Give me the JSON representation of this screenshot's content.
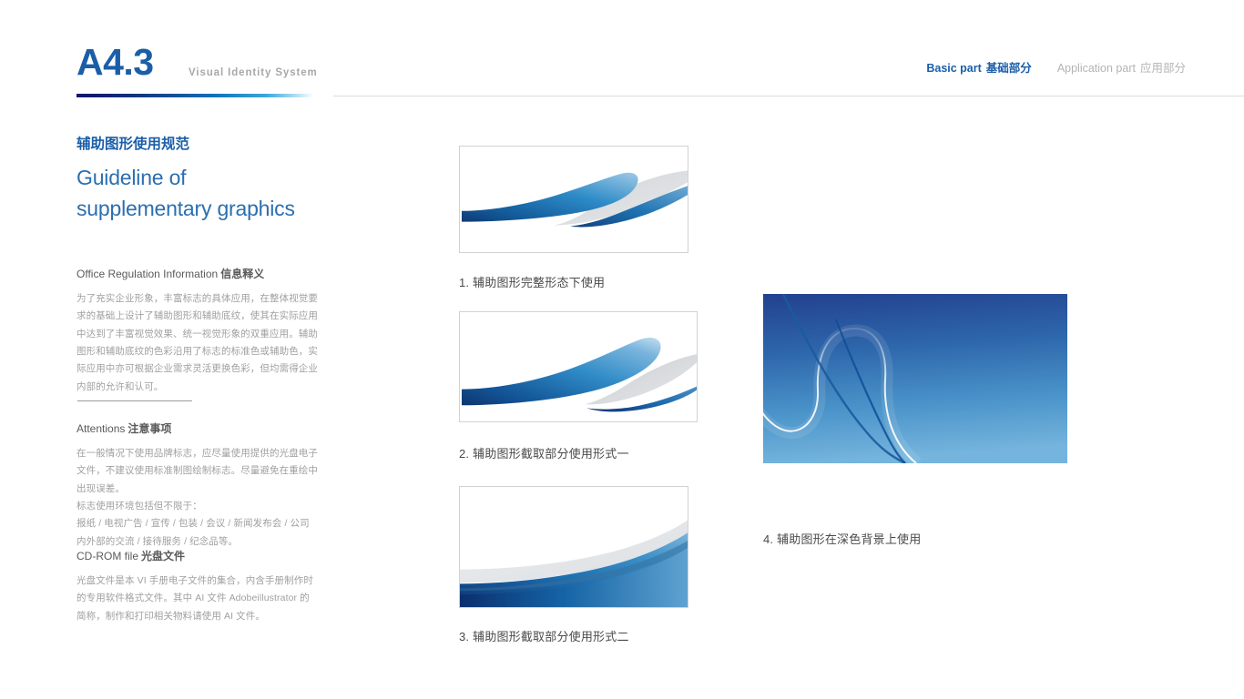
{
  "header": {
    "page_code": "A4.3",
    "subtitle": "Visual Identity System",
    "nav": [
      {
        "id": "basic",
        "en": "Basic part",
        "cn": "基础部分",
        "active": true
      },
      {
        "id": "application",
        "en": "Application part",
        "cn": "应用部分",
        "active": false
      }
    ],
    "accent_color": "#1b5ea8",
    "rule_color": "#dcdcdc"
  },
  "left_column": {
    "section_title_cn": "辅助图形使用规范",
    "section_title_en": "Guideline of supplementary graphics",
    "blocks": [
      {
        "id": "office-regulation",
        "head_en": "Office Regulation Information",
        "head_cn": "信息释义",
        "body": "为了充实企业形象，丰富标志的具体应用，在整体视觉要求的基础上设计了辅助图形和辅助底纹，使其在实际应用中达到了丰富视觉效果、统一视觉形象的双重应用。辅助图形和辅助底纹的色彩沿用了标志的标准色或辅助色，实际应用中亦可根据企业需求灵活更换色彩，但均需得企业内部的允许和认可。"
      },
      {
        "id": "attentions",
        "head_en": "Attentions",
        "head_cn": "注意事项",
        "body": "在一般情况下使用品牌标志，应尽量使用提供的光盘电子文件，不建议使用标准制图绘制标志。尽量避免在重绘中出现误差。\n标志使用环境包括但不限于：\n报纸 / 电视广告 / 宣传 / 包装 / 会议 / 新闻发布会 / 公司内外部的交流 / 接待服务 / 纪念品等。"
      },
      {
        "id": "cdrom-file",
        "head_en": "CD-ROM file",
        "head_cn": "光盘文件",
        "body": "光盘文件是本 VI 手册电子文件的集合，内含手册制作时的专用软件格式文件。其中 AI 文件 Adobeillustrator 的简称，制作和打印相关物料请使用 AI 文件。"
      }
    ]
  },
  "panels": [
    {
      "id": "panel-1",
      "caption": "1. 辅助图形完整形态下使用",
      "variant": "full-form"
    },
    {
      "id": "panel-2",
      "caption": "2. 辅助图形截取部分使用形式一",
      "variant": "crop-one"
    },
    {
      "id": "panel-3",
      "caption": "3. 辅助图形截取部分使用形式二",
      "variant": "crop-two"
    },
    {
      "id": "panel-4",
      "caption": "4. 辅助图形在深色背景上使用",
      "variant": "dark-background"
    }
  ],
  "colors": {
    "brand_blue": "#1b5ea8",
    "title_blue": "#2b6fb0",
    "dark_navy": "#11196b",
    "mid_blue": "#1070b8",
    "light_blue": "#5ba3d8",
    "grey_wave": "#d4d6d8",
    "body_text": "#a0a0a0",
    "caption_text": "#4a4a4a",
    "panel_border": "#d2d2d2"
  }
}
